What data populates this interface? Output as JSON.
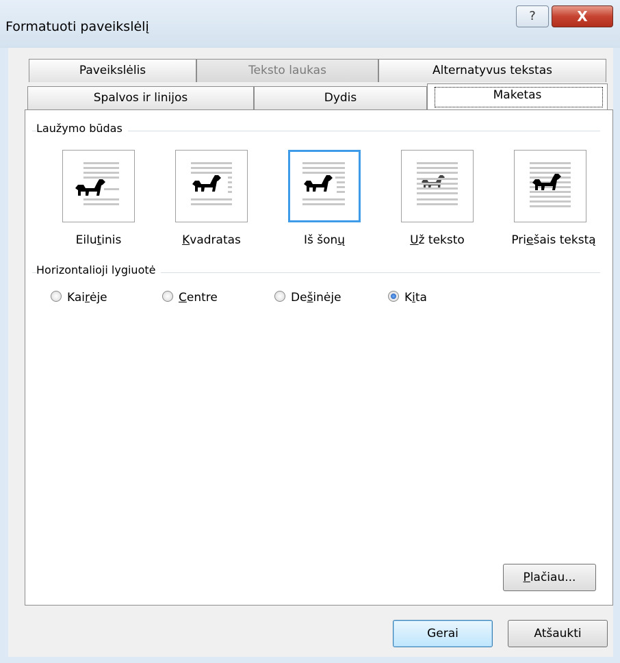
{
  "window": {
    "title": "Formatuoti paveikslėlį",
    "help_glyph": "?",
    "close_glyph": "X"
  },
  "tabs": {
    "row1": [
      {
        "label": "Paveikslėlis",
        "state": "normal"
      },
      {
        "label": "Teksto laukas",
        "state": "disabled"
      },
      {
        "label": "Alternatyvus tekstas",
        "state": "normal"
      }
    ],
    "row2": [
      {
        "label": "Spalvos ir linijos",
        "state": "normal"
      },
      {
        "label": "Dydis",
        "state": "normal"
      },
      {
        "label": "Maketas",
        "state": "active"
      }
    ]
  },
  "wrapping": {
    "group_label": "Laužymo būdas",
    "options": [
      {
        "pre": "Eilu",
        "u": "t",
        "post": "inis",
        "icon": "wrap-inline-icon",
        "selected": false
      },
      {
        "pre": "",
        "u": "K",
        "post": "vadratas",
        "icon": "wrap-square-icon",
        "selected": false
      },
      {
        "pre": "Iš šon",
        "u": "ų",
        "post": "",
        "icon": "wrap-tight-icon",
        "selected": true
      },
      {
        "pre": "",
        "u": "U",
        "post": "ž teksto",
        "icon": "wrap-behind-text-icon",
        "selected": false
      },
      {
        "pre": "Pri",
        "u": "e",
        "post": "šais tekstą",
        "icon": "wrap-in-front-icon",
        "selected": false
      }
    ]
  },
  "alignment": {
    "group_label": "Horizontalioji lygiuotė",
    "options": [
      {
        "pre": "Kai",
        "u": "r",
        "post": "ėje",
        "checked": false
      },
      {
        "pre": "",
        "u": "C",
        "post": "entre",
        "checked": false
      },
      {
        "pre": "De",
        "u": "š",
        "post": "inėje",
        "checked": false
      },
      {
        "pre": "K",
        "u": "i",
        "post": "ta",
        "checked": true
      }
    ]
  },
  "buttons": {
    "advanced": {
      "pre": "",
      "u": "P",
      "post": "lačiau..."
    },
    "ok": "Gerai",
    "cancel": "Atšaukti"
  },
  "colors": {
    "selection_border": "#3d9be9",
    "close_button": "#c64431"
  }
}
